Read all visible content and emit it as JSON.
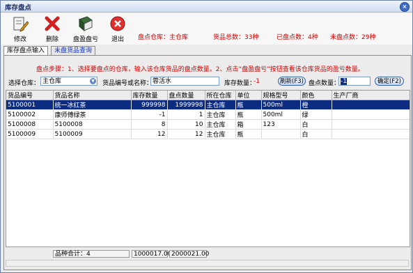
{
  "window": {
    "title": "库存盘点"
  },
  "toolbar": {
    "buttons": [
      {
        "label": "修改",
        "icon": "edit-icon"
      },
      {
        "label": "删除",
        "icon": "delete-icon"
      },
      {
        "label": "盘盈盘亏",
        "icon": "book-icon"
      },
      {
        "label": "退出",
        "icon": "exit-icon"
      }
    ],
    "stats": {
      "warehouse": "盘点仓库：主仓库",
      "total": "货品总数：33种",
      "counted": "已盘点数：4种",
      "uncounted": "未盘点数：29种"
    }
  },
  "tabs": [
    {
      "label": "库存盘点输入",
      "active": true
    },
    {
      "label": "未盘货品查询",
      "active": false
    }
  ],
  "instructions": "盘点步骤：1、选择要盘点的仓库，输入该仓库货品的盘点数量。2、点击“盘盈盘亏”按钮查看该仓库货品的盈亏数量。",
  "form": {
    "warehouse_label": "选择仓库：",
    "warehouse_value": "主仓库",
    "item_label": "货品编号或名称：",
    "item_value": "蓉活水",
    "stock_label": "库存数量：",
    "stock_value": "-1",
    "refresh_button": "刷新(F3)",
    "count_label": "盘点数量：",
    "count_value": "-1",
    "confirm_button": "确定(F2)"
  },
  "table": {
    "columns": [
      "货品编号",
      "货品名称",
      "库存数量",
      "盘点数量",
      "所在仓库",
      "单位",
      "规格型号",
      "颜色",
      "生产厂商"
    ],
    "rows": [
      [
        "5100001",
        "统一冰红茶",
        "999998",
        "1999998",
        "主仓库",
        "瓶",
        "500ml",
        "橙",
        ""
      ],
      [
        "5100002",
        "康师傅绿茶",
        "-1",
        "1",
        "主仓库",
        "瓶",
        "500ml",
        "绿",
        ""
      ],
      [
        "5100008",
        "5100008",
        "8",
        "10",
        "主仓库",
        "箱",
        "123",
        "白",
        ""
      ],
      [
        "5100009",
        "5100009",
        "12",
        "12",
        "主仓库",
        "瓶",
        "",
        "白",
        ""
      ]
    ],
    "selected_row": 0
  },
  "footer": {
    "variety_count": "品种合计：4",
    "stock_total": "1000017.00",
    "count_total": "2000021.00"
  },
  "colors": {
    "accent": "#d40000",
    "selection": "#0c2c82",
    "link": "#1433b8"
  }
}
